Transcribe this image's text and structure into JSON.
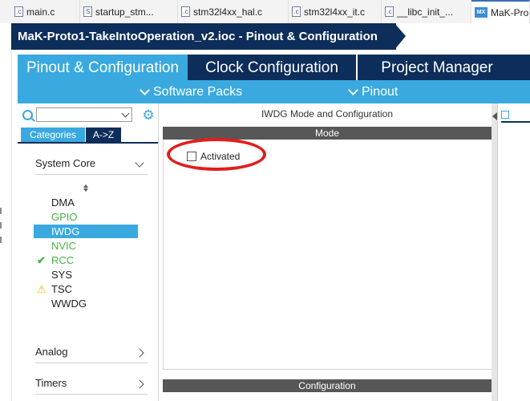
{
  "editor_tabs": [
    {
      "icon": "c-file-icon",
      "icon_text": ".c",
      "label": "main.c"
    },
    {
      "icon": "s-file-icon",
      "icon_text": "S",
      "label": "startup_stm..."
    },
    {
      "icon": "c-file-icon",
      "icon_text": ".c",
      "label": "stm32l4xx_hal.c"
    },
    {
      "icon": "c-file-icon",
      "icon_text": ".c",
      "label": "stm32l4xx_it.c"
    },
    {
      "icon": "c-file-icon",
      "icon_text": ".c",
      "label": "__libc_init_..."
    },
    {
      "icon": "mx-file-icon",
      "icon_text": "MX",
      "label": "MaK-Pro"
    }
  ],
  "breadcrumb": {
    "title": "MaK-Proto1-TakeIntoOperation_v2.ioc - Pinout & Configuration"
  },
  "main_tabs": [
    "Pinout & Configuration",
    "Clock Configuration",
    "Project Manager"
  ],
  "subbar": {
    "software_packs": "Software Packs",
    "pinout": "Pinout"
  },
  "left_panel": {
    "search_placeholder": "",
    "category_tabs": {
      "categories": "Categories",
      "az": "A->Z"
    },
    "sections": {
      "system_core": "System Core",
      "analog": "Analog",
      "timers": "Timers"
    },
    "peripherals": [
      {
        "label": "DMA",
        "status": "none"
      },
      {
        "label": "GPIO",
        "status": "green"
      },
      {
        "label": "IWDG",
        "status": "selected"
      },
      {
        "label": "NVIC",
        "status": "green"
      },
      {
        "label": "RCC",
        "status": "check"
      },
      {
        "label": "SYS",
        "status": "none"
      },
      {
        "label": "TSC",
        "status": "warning"
      },
      {
        "label": "WWDG",
        "status": "none"
      }
    ]
  },
  "mode_panel": {
    "title": "IWDG Mode and Configuration",
    "mode_header": "Mode",
    "activated_label": "Activated",
    "activated_checked": false,
    "configuration_header": "Configuration"
  },
  "right_panel": {
    "tab_label": ""
  },
  "colors": {
    "navy": "#0d2e5a",
    "accent": "#39a9e0",
    "green": "#48b04a",
    "highlight": "#e21d1d",
    "warning": "#f2b400"
  }
}
